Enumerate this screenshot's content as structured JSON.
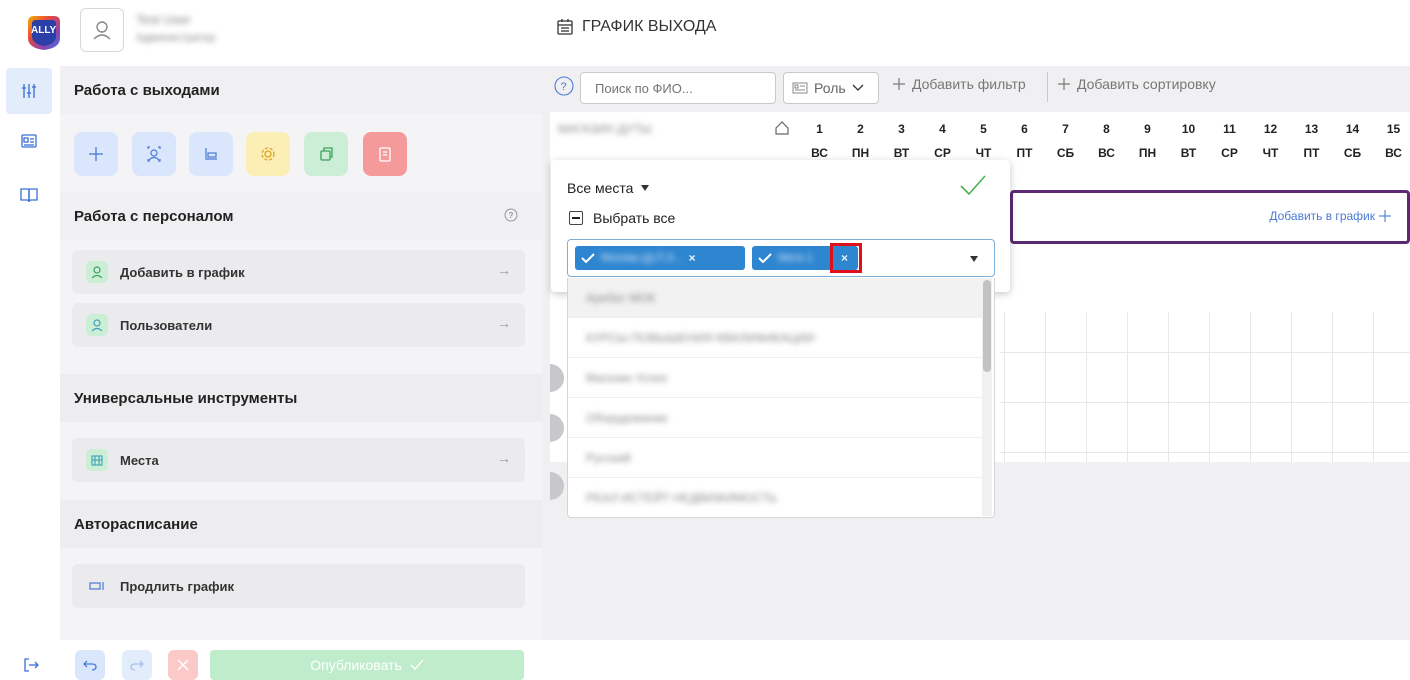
{
  "header": {
    "page_title": "ГРАФИК ВЫХОДА",
    "logo_text": "ALLY",
    "user_name": "Test User",
    "user_role": "Администратор"
  },
  "panel": {
    "section_exits": "Работа с выходами",
    "section_staff": "Работа с персоналом",
    "staff_items": [
      {
        "label": "Добавить в график"
      },
      {
        "label": "Пользователи"
      }
    ],
    "section_tools": "Универсальные инструменты",
    "tools_items": [
      {
        "label": "Места"
      }
    ],
    "section_auto": "Авторасписание",
    "auto_items": [
      {
        "label": "Продлить график"
      }
    ],
    "publish_label": "Опубликовать"
  },
  "toolbar": {
    "search_placeholder": "Поиск по ФИО...",
    "role_label": "Роль",
    "add_filter": "Добавить фильтр",
    "add_sort": "Добавить сортировку"
  },
  "calendar": {
    "org_name": "МАГАЗИН ДУТЫ",
    "days": [
      {
        "num": "1",
        "wd": "ВС"
      },
      {
        "num": "2",
        "wd": "ПН"
      },
      {
        "num": "3",
        "wd": "ВТ"
      },
      {
        "num": "4",
        "wd": "СР"
      },
      {
        "num": "5",
        "wd": "ЧТ"
      },
      {
        "num": "6",
        "wd": "ПТ"
      },
      {
        "num": "7",
        "wd": "СБ"
      },
      {
        "num": "8",
        "wd": "ВС"
      },
      {
        "num": "9",
        "wd": "ПН"
      },
      {
        "num": "10",
        "wd": "ВТ"
      },
      {
        "num": "11",
        "wd": "СР"
      },
      {
        "num": "12",
        "wd": "ЧТ"
      },
      {
        "num": "13",
        "wd": "ПТ"
      },
      {
        "num": "14",
        "wd": "СБ"
      },
      {
        "num": "15",
        "wd": "ВС"
      }
    ],
    "add_to_graph": "Добавить в график"
  },
  "popup": {
    "title": "Все места",
    "select_all": "Выбрать все",
    "tags": [
      {
        "label": "Москва (Д.П.З..."
      },
      {
        "label": "Мега 1"
      }
    ],
    "options": [
      {
        "label": "Аребат МОК"
      },
      {
        "label": "КУРСЫ ПОВЫШЕНИЯ КВАЛИФИКАЦИИ"
      },
      {
        "label": "Магазин Успех"
      },
      {
        "label": "Оборудование"
      },
      {
        "label": "Русский"
      },
      {
        "label": "РЕАЛ ИСТЕЙТ НЕДВИЖИМОСТЬ"
      }
    ]
  }
}
